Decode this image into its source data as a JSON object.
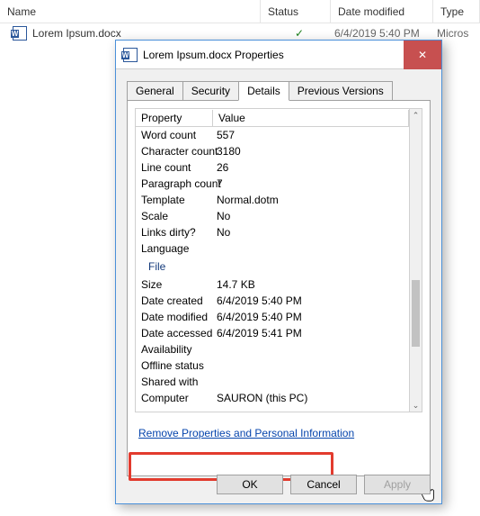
{
  "filelist": {
    "headers": {
      "name": "Name",
      "status": "Status",
      "date": "Date modified",
      "type": "Type"
    },
    "row": {
      "name": "Lorem Ipsum.docx",
      "status": "✓",
      "date": "6/4/2019 5:40 PM",
      "type": "Micros"
    }
  },
  "dialog": {
    "title": "Lorem Ipsum.docx Properties",
    "tabs": {
      "general": "General",
      "security": "Security",
      "details": "Details",
      "previous": "Previous Versions"
    },
    "grid_headers": {
      "property": "Property",
      "value": "Value"
    },
    "rows": {
      "word_count": {
        "p": "Word count",
        "v": "557"
      },
      "char_count": {
        "p": "Character count",
        "v": "3180"
      },
      "line_count": {
        "p": "Line count",
        "v": "26"
      },
      "para_count": {
        "p": "Paragraph count",
        "v": "7"
      },
      "template": {
        "p": "Template",
        "v": "Normal.dotm"
      },
      "scale": {
        "p": "Scale",
        "v": "No"
      },
      "links_dirty": {
        "p": "Links dirty?",
        "v": "No"
      },
      "language": {
        "p": "Language",
        "v": ""
      },
      "section_file": "File",
      "size": {
        "p": "Size",
        "v": "14.7 KB"
      },
      "date_created": {
        "p": "Date created",
        "v": "6/4/2019 5:40 PM"
      },
      "date_modified": {
        "p": "Date modified",
        "v": "6/4/2019 5:40 PM"
      },
      "date_accessed": {
        "p": "Date accessed",
        "v": "6/4/2019 5:41 PM"
      },
      "availability": {
        "p": "Availability",
        "v": ""
      },
      "offline": {
        "p": "Offline status",
        "v": ""
      },
      "shared": {
        "p": "Shared with",
        "v": ""
      },
      "computer": {
        "p": "Computer",
        "v": "SAURON (this PC)"
      }
    },
    "remove_link": "Remove Properties and Personal Information",
    "buttons": {
      "ok": "OK",
      "cancel": "Cancel",
      "apply": "Apply"
    }
  }
}
